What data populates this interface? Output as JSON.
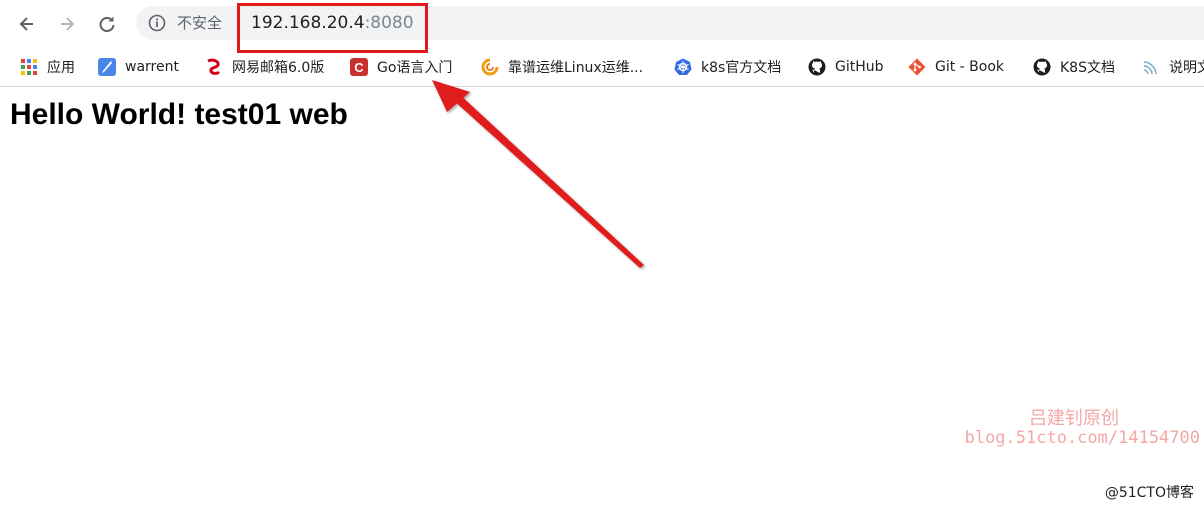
{
  "toolbar": {
    "back_icon": "arrow-left-icon",
    "forward_icon": "arrow-right-icon",
    "reload_icon": "reload-icon",
    "security_label": "不安全",
    "url_host": "192.168.20.4",
    "url_port": ":8080"
  },
  "bookmarks": [
    {
      "label": "应用",
      "icon": "apps-grid-icon"
    },
    {
      "label": "warrent",
      "icon": "quill-icon"
    },
    {
      "label": "网易邮箱6.0版",
      "icon": "netease-mail-icon"
    },
    {
      "label": "Go语言入门",
      "icon": "c-logo-icon"
    },
    {
      "label": "靠谱运维Linux运维...",
      "icon": "swirl-logo-icon"
    },
    {
      "label": "k8s官方文档",
      "icon": "kubernetes-icon"
    },
    {
      "label": "GitHub",
      "icon": "github-icon"
    },
    {
      "label": "Git - Book",
      "icon": "git-icon"
    },
    {
      "label": "K8S文档",
      "icon": "github-icon"
    },
    {
      "label": "说明文",
      "icon": "wifi-waves-icon"
    }
  ],
  "page": {
    "heading": "Hello World! test01 web"
  },
  "annotation": {
    "color": "#e11b1b"
  },
  "watermark": {
    "line1": "吕建钊原创",
    "line2": "blog.51cto.com/14154700",
    "corner": "@51CTO博客"
  }
}
